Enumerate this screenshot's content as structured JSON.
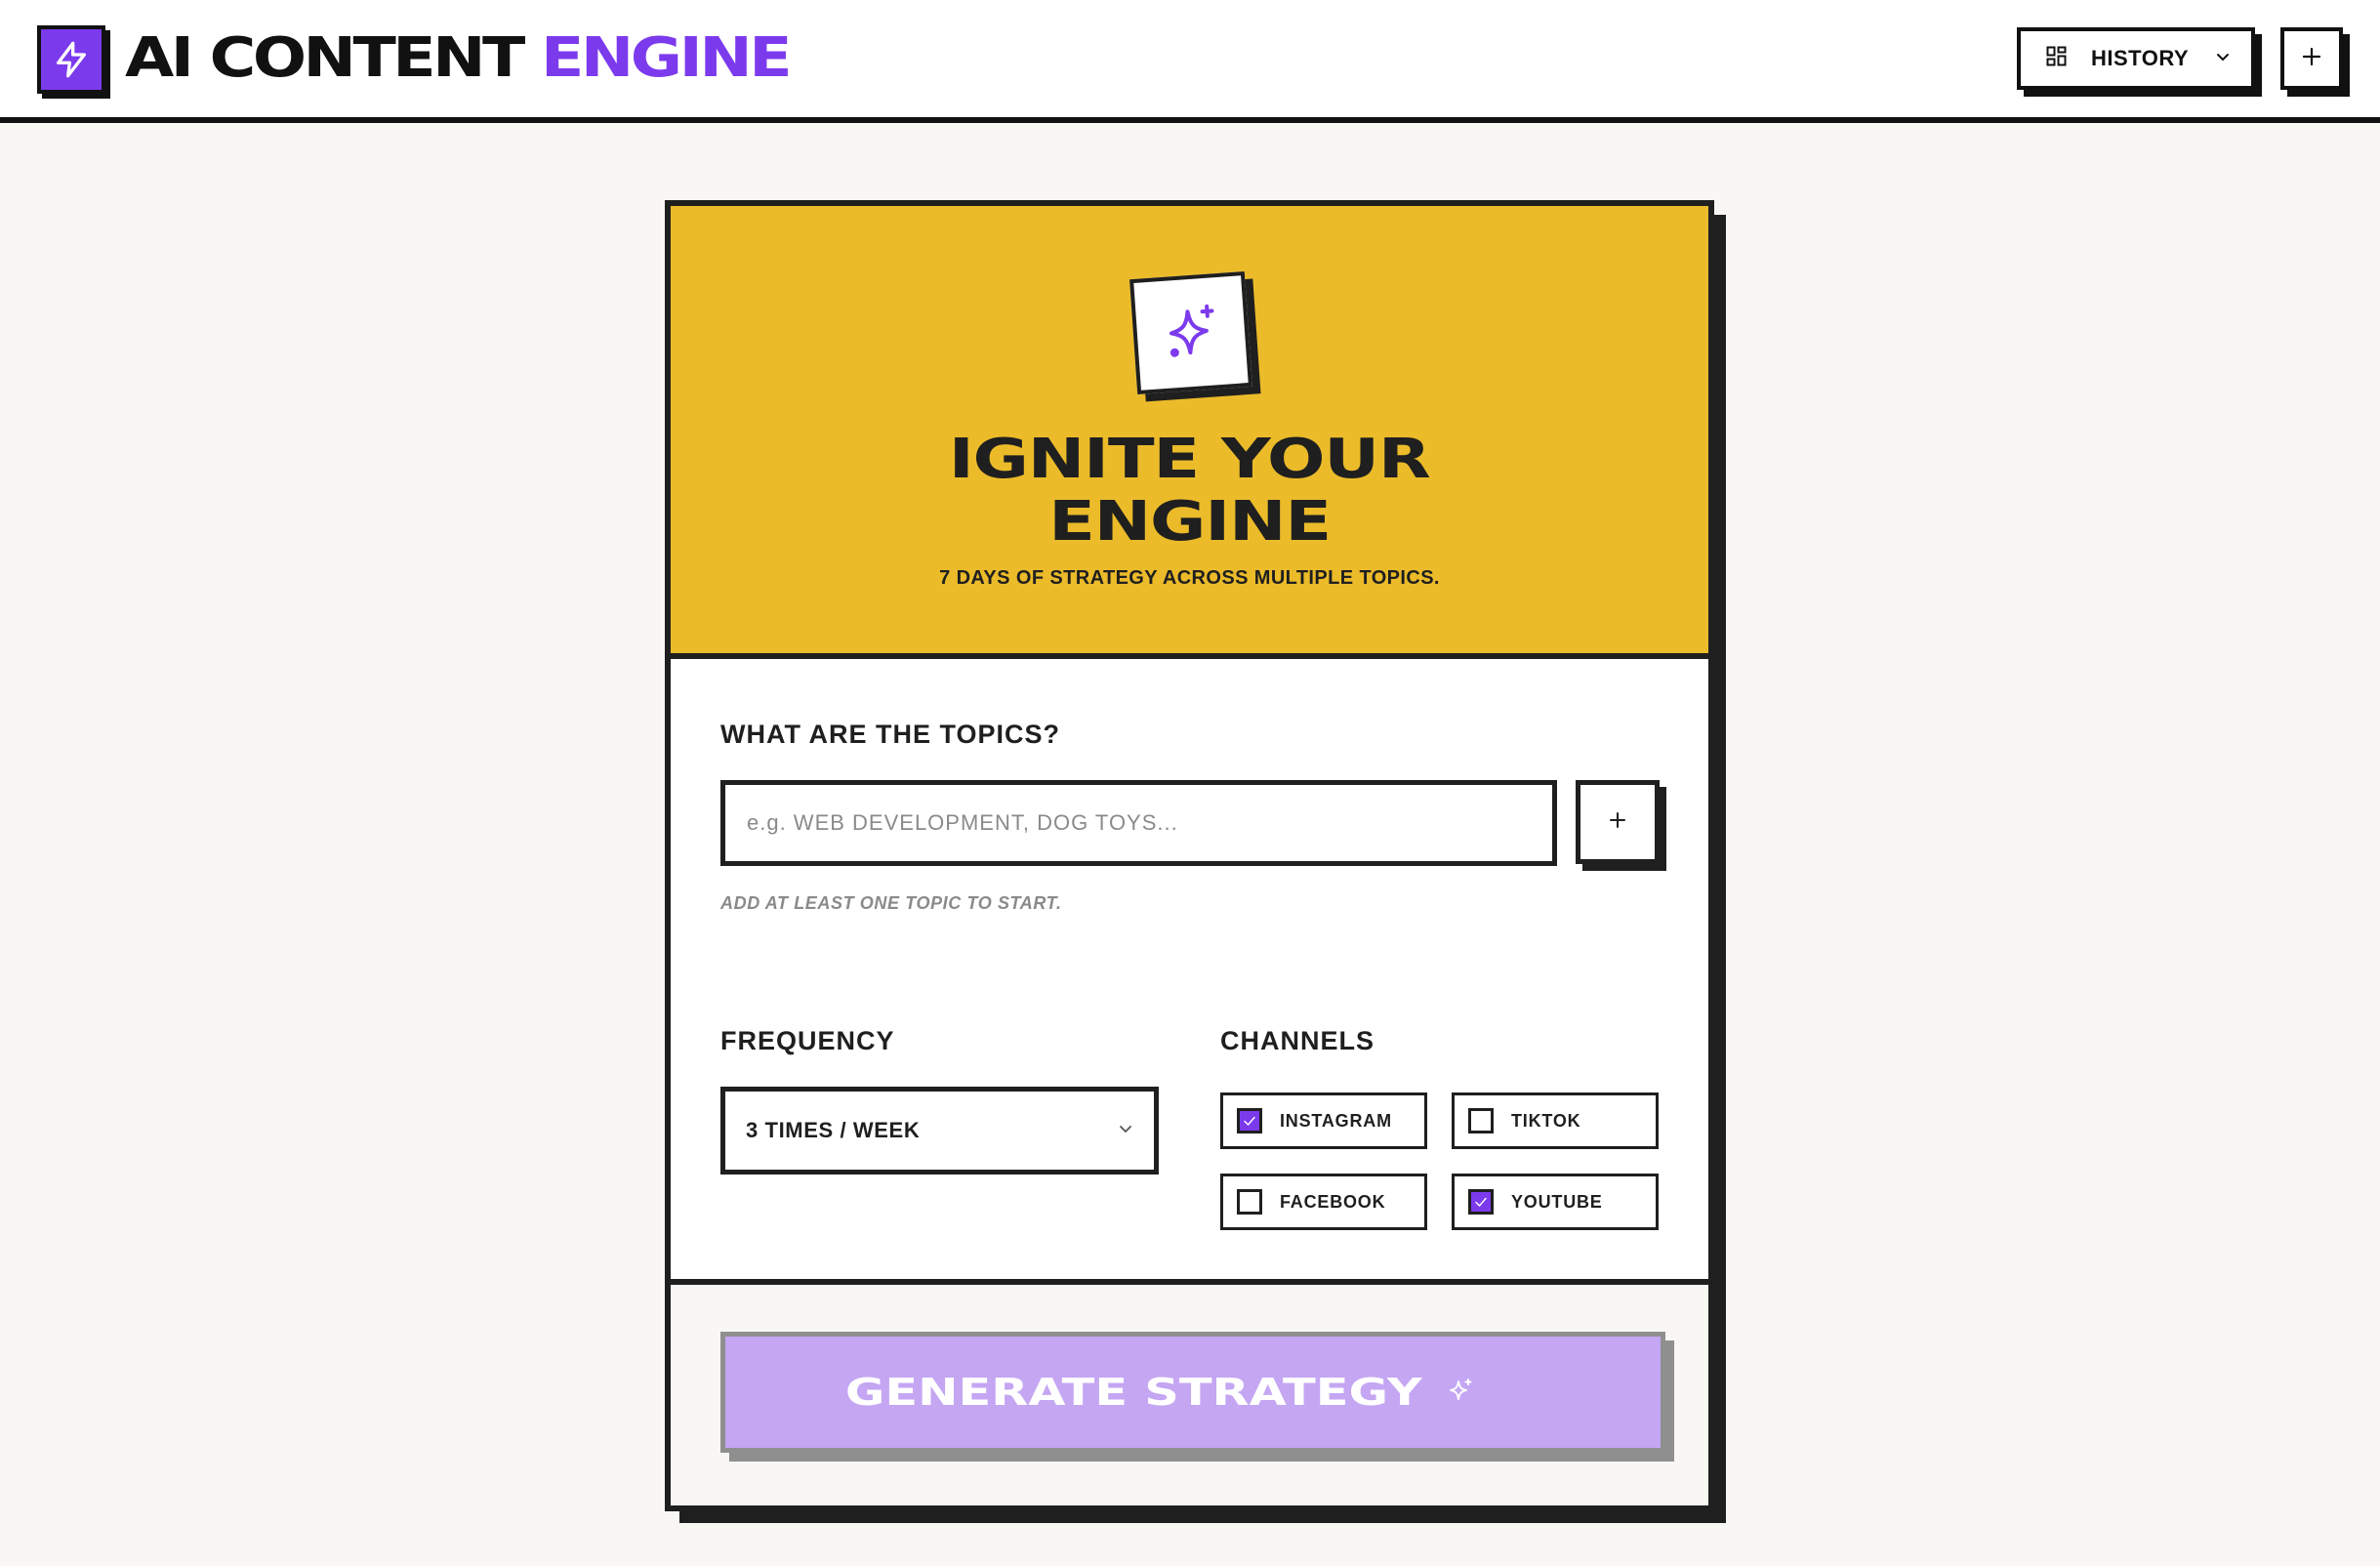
{
  "app": {
    "title_main": "AI CONTENT",
    "title_accent": "ENGINE"
  },
  "header": {
    "history_label": "HISTORY",
    "new_icon": "plus-icon",
    "history_icon": "grid-icon"
  },
  "hero": {
    "title_line1": "IGNITE YOUR",
    "title_line2": "ENGINE",
    "subtitle": "7 DAYS OF STRATEGY ACROSS MULTIPLE TOPICS.",
    "icon": "sparkles-icon"
  },
  "topics": {
    "label": "WHAT ARE THE TOPICS?",
    "placeholder": "e.g. WEB DEVELOPMENT, DOG TOYS...",
    "value": "",
    "hint": "ADD AT LEAST ONE TOPIC TO START."
  },
  "frequency": {
    "label": "FREQUENCY",
    "selected": "3 TIMES / WEEK"
  },
  "channels": {
    "label": "CHANNELS",
    "items": [
      {
        "label": "INSTAGRAM",
        "checked": true
      },
      {
        "label": "TIKTOK",
        "checked": false
      },
      {
        "label": "FACEBOOK",
        "checked": false
      },
      {
        "label": "YOUTUBE",
        "checked": true
      }
    ]
  },
  "action": {
    "generate_label": "GENERATE STRATEGY"
  },
  "colors": {
    "accent": "#7c3aed",
    "hero_bg": "#ebbb2a",
    "generate_disabled_bg": "#c4a6f3",
    "ink": "#1f1f1f",
    "page_bg": "#f8f7f4"
  }
}
